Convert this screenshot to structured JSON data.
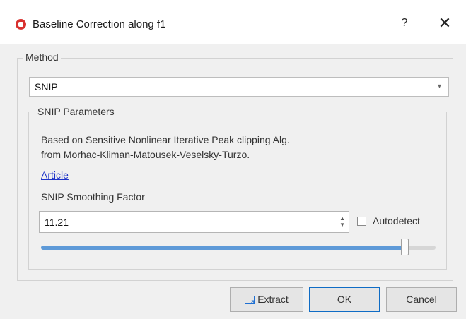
{
  "window": {
    "title": "Baseline Correction along f1",
    "help_label": "?",
    "close_label": "✕"
  },
  "method": {
    "group_label": "Method",
    "selected": "SNIP",
    "dropdown_arrow": "▾"
  },
  "snip": {
    "group_label": "SNIP Parameters",
    "description_line1": "Based on Sensitive Nonlinear Iterative Peak clipping Alg.",
    "description_line2": "from Morhac-Kliman-Matousek-Veselsky-Turzo.",
    "article_link": "Article",
    "smoothing_label": "SNIP Smoothing Factor",
    "smoothing_value": "11.21",
    "spin_up": "▲",
    "spin_down": "▼",
    "autodetect_label": "Autodetect",
    "autodetect_checked": false,
    "slider_fraction": 0.923
  },
  "buttons": {
    "extract": "Extract",
    "ok": "OK",
    "cancel": "Cancel"
  },
  "icons": {
    "app": "app-logo-icon",
    "help": "help-icon",
    "close": "close-icon",
    "extract": "extract-icon"
  }
}
